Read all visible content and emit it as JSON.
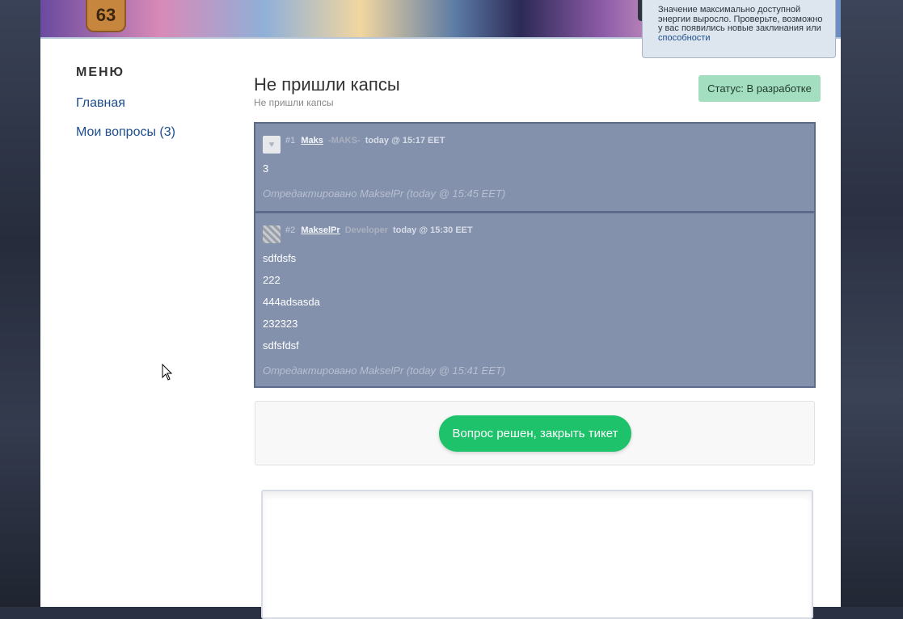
{
  "header": {
    "level": "63"
  },
  "notification": {
    "text": "Значение максимально доступной энергии выросло. Проверьте, возможно у вас появились новые заклинания или",
    "link": "способности"
  },
  "sidebar": {
    "title": "МЕНЮ",
    "items": [
      {
        "label": "Главная"
      },
      {
        "label": "Мои вопросы (3)"
      }
    ]
  },
  "ticket": {
    "title": "Не пришли капсы",
    "subtitle": "Не пришли капсы",
    "status": "Статус: В разработке"
  },
  "posts": [
    {
      "num": "#1",
      "author": "Maks",
      "role": "-MAKS-",
      "time": "today @ 15:17 EET",
      "lines": [
        "3"
      ],
      "edited": "Отредактировано MakselPr (today @ 15:45 EET)"
    },
    {
      "num": "#2",
      "author": "MakselPr",
      "role": "Developer",
      "time": "today @ 15:30 EET",
      "lines": [
        "sdfdsfs",
        "222",
        "444adsasda",
        "232323",
        "sdfsfdsf"
      ],
      "edited": "Отредактировано MakselPr (today @ 15:41 EET)"
    }
  ],
  "actions": {
    "close_label": "Вопрос решен, закрыть тикет"
  },
  "colors": {
    "thread_bg": "#8391ad",
    "status_bg": "#a3dec0",
    "close_button": "#1ec26a",
    "link": "#1d4d8c"
  }
}
